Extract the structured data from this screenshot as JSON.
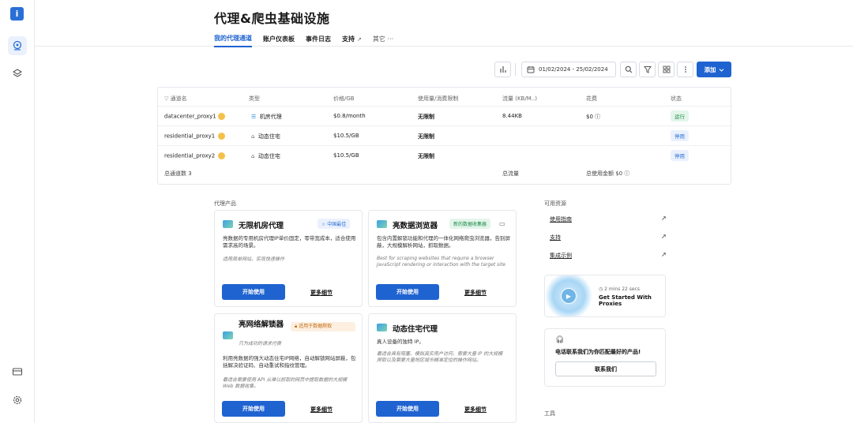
{
  "rail": {
    "logo_glyph": "i",
    "items": [
      {
        "name": "proxy-location-icon",
        "active": true
      },
      {
        "name": "layers-icon",
        "active": false
      }
    ],
    "bottom": [
      "billing-card-icon",
      "settings-gear-icon"
    ]
  },
  "header": {
    "title": "代理&爬虫基础设施",
    "tabs": [
      {
        "label": "我的代理通道",
        "active": true
      },
      {
        "label": "账户仪表板",
        "active": false
      },
      {
        "label": "事件日志",
        "active": false
      },
      {
        "label": "支持",
        "active": false,
        "external": true
      },
      {
        "label": "其它 ···",
        "active": false,
        "muted": true
      }
    ]
  },
  "toolbar": {
    "date_range": "01/02/2024 - 25/02/2024",
    "add_label": "添加"
  },
  "table": {
    "headers": [
      "通道名",
      "类型",
      "价格/GB",
      "使用量/消费限制",
      "流量 (KB/M..)",
      "花费",
      "状态"
    ],
    "rows": [
      {
        "name": "datacenter_proxy1",
        "type": "机房代理",
        "price": "$0.8/month",
        "limit": "无限制",
        "traffic": "8.44KB",
        "cost": "$0",
        "status": "运行",
        "status_kind": "run"
      },
      {
        "name": "residential_proxy1",
        "type": "动态住宅",
        "price": "$10.5/GB",
        "limit": "无限制",
        "traffic": "",
        "cost": "",
        "status": "停用",
        "status_kind": "stop"
      },
      {
        "name": "residential_proxy2",
        "type": "动态住宅",
        "price": "$10.5/GB",
        "limit": "无限制",
        "traffic": "",
        "cost": "",
        "status": "停用",
        "status_kind": "stop"
      }
    ],
    "footer": {
      "count": "总通道数 3",
      "traffic": "总流量",
      "total_cost": "总使用金额 $0"
    }
  },
  "products": {
    "section_label": "代理产品",
    "cards": [
      {
        "title": "无限机房代理",
        "tag": "中国最佳",
        "tag_color": "blue",
        "desc": "亮数据的专用机房代理IP单价固定，零带宽成本，适合使用需求高的场景。",
        "note": "适用简单网站，实现快速操作",
        "start": "开始使用",
        "more": "更多细节"
      },
      {
        "title": "亮数据浏览器",
        "tag": "新的数据收集器",
        "tag_color": "green",
        "desc": "包含内置解锁功能和代理的一体化网络爬虫浏览器，告别屏蔽，大规模解析网站，抓取数据。",
        "note": "Best for scraping websites that require a browser JavaScript rendering or interaction with the target site",
        "start": "开始使用",
        "more": "更多细节"
      },
      {
        "title": "亮网络解锁器",
        "subtitle": "只为成功的请求付费",
        "tag": "适用于数据爬取",
        "tag_color": "orange",
        "desc": "利用亮数据的强大动态住宅IP网络，自动解锁网站屏蔽，包括解决验证码、自动重试和指纹管理。",
        "note": "最适合需要使用 API 从难以抓取的网页中提取数据的大规模 Web 数据收集。",
        "start": "开始使用",
        "more": "更多细节"
      },
      {
        "title": "动态住宅代理",
        "desc": "真人设备的独特 IP。",
        "note": "最适合具有阻塞、模拟真实用户访问、需要大量 IP 的大规模爬取以及需要大量地区城市精准定位的操作网站。",
        "start": "开始使用",
        "more": "更多细节"
      }
    ]
  },
  "resources": {
    "section_label": "可用资源",
    "links": [
      "使用指南",
      "支持",
      "集成示例"
    ],
    "video": {
      "duration": "2 mins 22 secs",
      "title": "Get Started With Proxies"
    },
    "contact": {
      "text": "电话联系我们为你匹配最好的产品!",
      "button": "联系我们"
    },
    "tools_label": "工具"
  }
}
